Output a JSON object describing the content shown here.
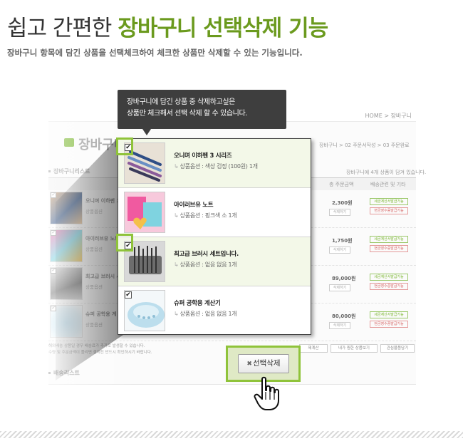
{
  "headline": {
    "light": "쉽고 간편한",
    "bold": "장바구니 선택삭제 기능"
  },
  "subheadline": "장바구니 항목에 담긴 상품을 선택체크하여 체크한 상품만 삭제할 수 있는 기능입니다.",
  "tooltip": {
    "line1": "장바구니에 담긴 상품 중 삭제하고싶은",
    "line2": "상품만 체크해서 선택 삭제 할 수 있습니다."
  },
  "background_page": {
    "breadcrumb": "HOME > 장바구니",
    "title": "장바구니",
    "steps": "장바구니 > 02 주문서작성 > 03 주문완료",
    "list_label": "장바구니리스트",
    "header_note": "장바구니에 4개 상품이 담겨 있습니다.",
    "columns": [
      "총 주문금액",
      "배송관련 및 기타"
    ],
    "rows": [
      {
        "name": "오니며 이하펜 3",
        "option": "상품옵션",
        "price": "2,300원",
        "delete": "삭제하기"
      },
      {
        "name": "아이러브유 노트",
        "option": "상품옵션",
        "price": "1,750원",
        "delete": "삭제하기"
      },
      {
        "name": "최고급 브러시 세",
        "option": "상품옵션",
        "price": "89,000원",
        "delete": "삭제하기"
      },
      {
        "name": "슈퍼 공학용 계",
        "option": "상품옵션",
        "price": "80,000원",
        "delete": "삭제하기"
      }
    ],
    "tag_green": "세금계산서발급가능",
    "tag_red": "현금영수증발급가능",
    "notes": [
      "해외배송 상품일 경우 배송료가 추가로 발생할 수 있습니다.",
      "수량 및 주문금액이 틀리면 결제전 반드시 확인하시기 바랍니다."
    ],
    "buttons": [
      "제계산",
      "내가 찜한 상품보기",
      "관심물품담기"
    ],
    "ship_label": "배송리스트"
  },
  "zoom_rows": [
    {
      "name": "오니며 이하펜 3 시리즈",
      "option": "상품옵션 : 색상 검정 (100원) 1개",
      "checked": true,
      "selected": true
    },
    {
      "name": "아이러브유 노트",
      "option": "상품옵션 : 핑크색 소 1개",
      "checked": false,
      "selected": false
    },
    {
      "name": "최고급 브러시 세트입니다.",
      "option": "상품옵션 : 없음 없음 1개",
      "checked": true,
      "selected": true
    },
    {
      "name": "슈퍼 공학용 계산기",
      "option": "상품옵션 : 없음 없음 1개",
      "checked": true,
      "selected": false
    }
  ],
  "delete_button": {
    "label": "선택삭제",
    "icon": "x-icon"
  },
  "colors": {
    "accent_green": "#8fc33a",
    "headline_green": "#6b9a1e",
    "tooltip_bg": "#3e3e3e"
  }
}
